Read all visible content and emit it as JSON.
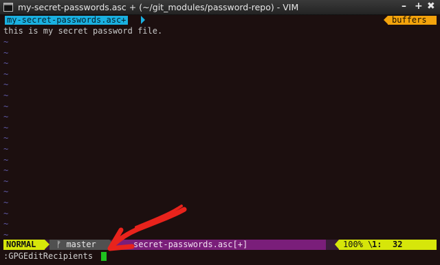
{
  "window": {
    "title": "my-secret-passwords.asc + (~/git_modules/password-repo) - VIM",
    "controls": {
      "minimize": "–",
      "maximize": "+",
      "close": "✖"
    }
  },
  "tabline": {
    "active_tab": "my-secret-passwords.asc+",
    "buffers_label": "buffers"
  },
  "buffer": {
    "lines": [
      "this is my secret password file."
    ],
    "empty_line_marker": "~"
  },
  "statusline": {
    "mode": "NORMAL",
    "branch_icon": "ᚠ",
    "branch": "master",
    "filename": "secret-passwords.asc[+]",
    "percent": "100% \\",
    "line_nr_icon": "1:",
    "position": "32"
  },
  "cmdline": {
    "text": ":GPGEditRecipients"
  },
  "colors": {
    "background": "#1c0f0f",
    "tab_accent": "#1ab0e0",
    "buffers_accent": "#f3a30c",
    "mode_accent": "#d6e60a",
    "file_segment": "#7a1e7a",
    "cursor": "#1fc21f",
    "annotation_arrow": "#e8231c"
  }
}
